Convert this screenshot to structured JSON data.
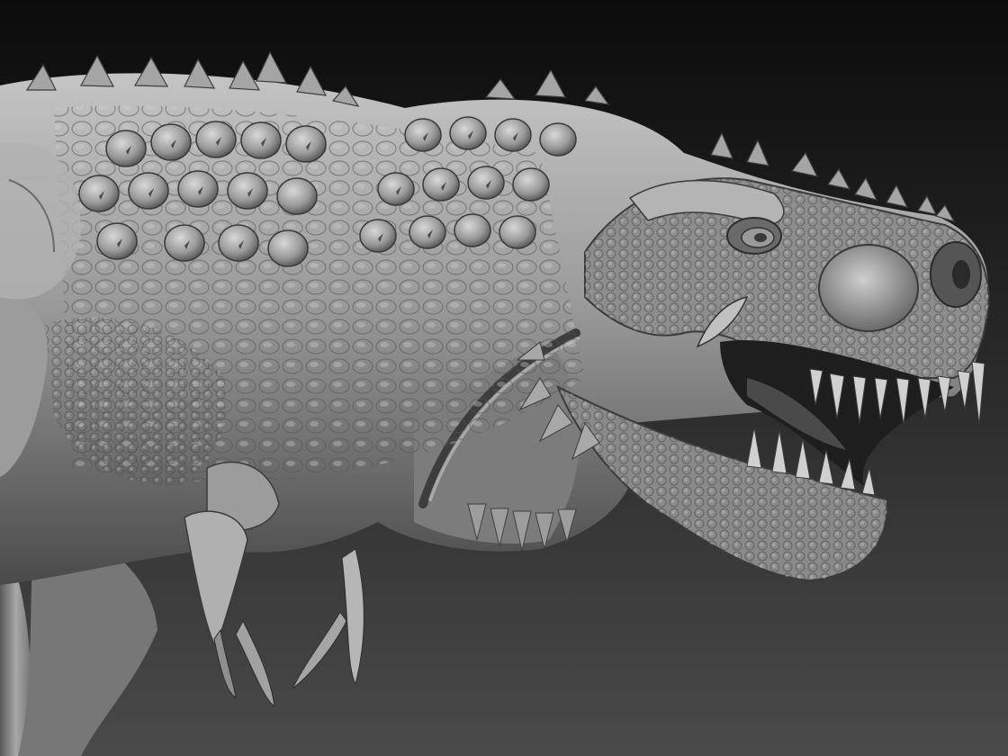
{
  "scene": {
    "subject": "tyrannosaurus-sculpt",
    "material": "grey-matcap-clay",
    "view": "three-quarter-profile-facing-right",
    "jaw_state": "open",
    "colors": {
      "background_top": "#0b0b0b",
      "background_bottom": "#4a4a4a",
      "clay_light": "#b8b8b8",
      "clay_mid": "#7e7e7e",
      "clay_dark": "#3a3a3a",
      "mouth_interior": "#1e1e1e"
    }
  }
}
